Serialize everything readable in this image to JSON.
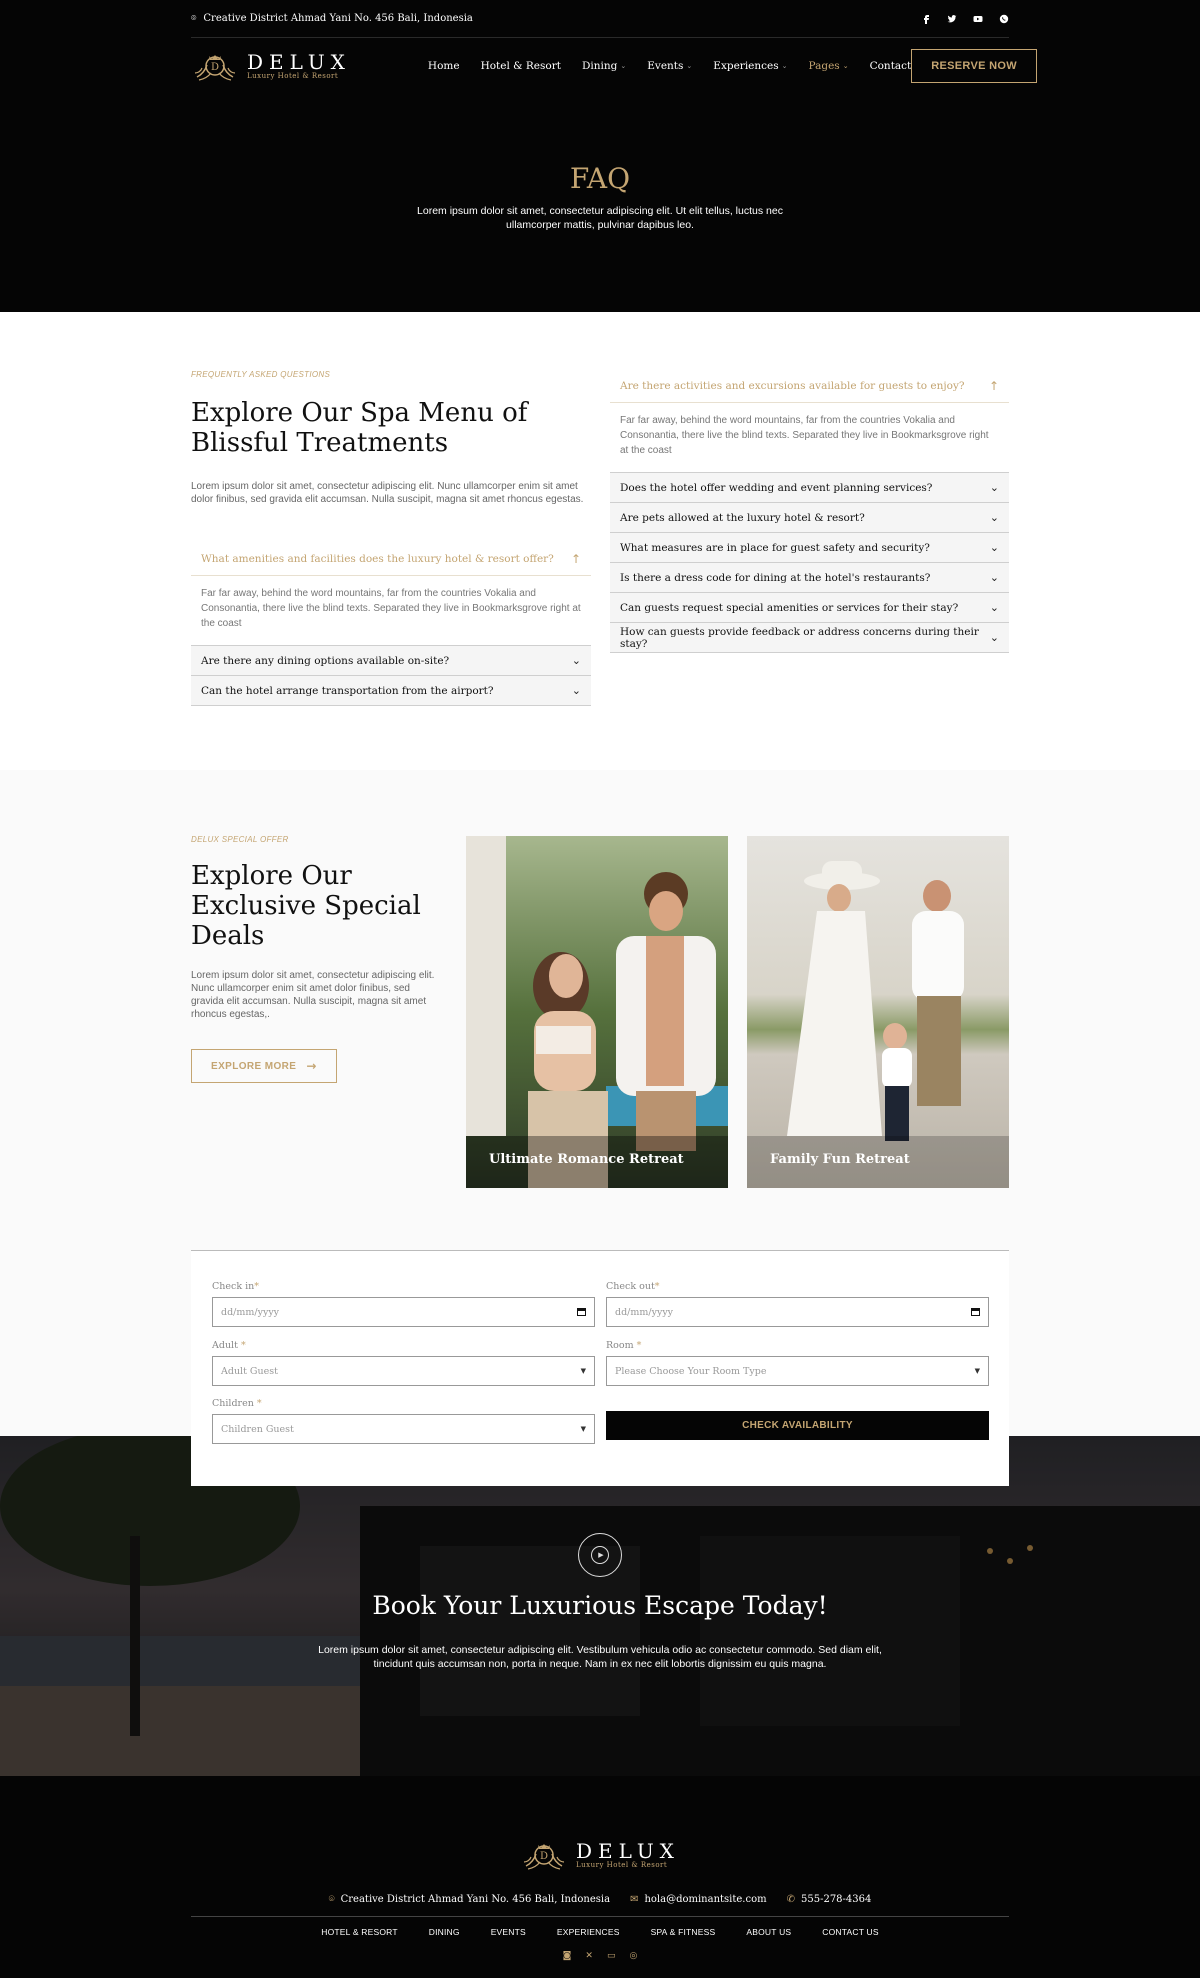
{
  "topbar": {
    "address": "Creative District Ahmad Yani No. 456 Bali, Indonesia",
    "social_icons": [
      "facebook-icon",
      "twitter-icon",
      "youtube-icon",
      "whatsapp-icon"
    ]
  },
  "brand": {
    "name": "DELUX",
    "tagline": "Luxury Hotel & Resort",
    "accent": "#c4a572",
    "dark": "#050505"
  },
  "nav": {
    "items": [
      {
        "label": "Home",
        "dropdown": false,
        "active": false
      },
      {
        "label": "Hotel & Resort",
        "dropdown": false,
        "active": false
      },
      {
        "label": "Dining",
        "dropdown": true,
        "active": false
      },
      {
        "label": "Events",
        "dropdown": true,
        "active": false
      },
      {
        "label": "Experiences",
        "dropdown": true,
        "active": false
      },
      {
        "label": "Pages",
        "dropdown": true,
        "active": true
      },
      {
        "label": "Contact",
        "dropdown": false,
        "active": false
      }
    ],
    "cta": "RESERVE NOW"
  },
  "hero": {
    "title": "FAQ",
    "subtitle": "Lorem ipsum dolor sit amet, consectetur adipiscing elit. Ut elit tellus, luctus nec ullamcorper mattis, pulvinar dapibus leo."
  },
  "faq": {
    "eyebrow": "FREQUENTLY ASKED QUESTIONS",
    "title": "Explore Our Spa Menu of Blissful Treatments",
    "intro": "Lorem ipsum dolor sit amet, consectetur adipiscing elit. Nunc ullamcorper enim sit amet dolor finibus, sed gravida elit accumsan. Nulla suscipit, magna sit amet rhoncus egestas.",
    "answer": "Far far away, behind the word mountains, far from the countries Vokalia and Consonantia, there live the blind texts. Separated they live in Bookmarksgrove right at the coast",
    "left": [
      {
        "q": "What amenities and facilities does the luxury hotel & resort offer?",
        "open": true
      },
      {
        "q": "Are there any dining options available on-site?",
        "open": false
      },
      {
        "q": "Can the hotel arrange transportation from the airport?",
        "open": false
      }
    ],
    "right": [
      {
        "q": "Are there activities and excursions available for guests to enjoy?",
        "open": true
      },
      {
        "q": "Does the hotel offer wedding and event planning services?",
        "open": false
      },
      {
        "q": "Are pets allowed at the luxury hotel & resort?",
        "open": false
      },
      {
        "q": "What measures are in place for guest safety and security?",
        "open": false
      },
      {
        "q": "Is there a dress code for dining at the hotel's restaurants?",
        "open": false
      },
      {
        "q": "Can guests request special amenities or services for their stay?",
        "open": false
      },
      {
        "q": "How can guests provide feedback or address concerns during their stay?",
        "open": false
      }
    ]
  },
  "deals": {
    "eyebrow": "DELUX SPECIAL OFFER",
    "title": "Explore Our Exclusive Special Deals",
    "intro": "Lorem ipsum dolor sit amet, consectetur adipiscing elit. Nunc ullamcorper enim sit amet dolor finibus, sed gravida elit accumsan. Nulla suscipit, magna sit amet rhoncus egestas,.",
    "button": "EXPLORE MORE",
    "cards": [
      {
        "caption": "Ultimate Romance Retreat"
      },
      {
        "caption": "Family Fun Retreat"
      }
    ]
  },
  "booking": {
    "checkin_label": "Check in",
    "checkin_placeholder": "dd/mm/yyyy",
    "checkout_label": "Check out",
    "checkout_placeholder": "dd/mm/yyyy",
    "adult_label": "Adult",
    "adult_value": "Adult Guest",
    "room_label": "Room",
    "room_value": "Please Choose Your Room Type",
    "children_label": "Children",
    "children_value": "Children Guest",
    "submit": "CHECK AVAILABILITY"
  },
  "cta": {
    "title": "Book Your Luxurious Escape Today!",
    "text": "Lorem ipsum dolor sit amet, consectetur adipiscing elit. Vestibulum vehicula odio ac consectetur commodo. Sed diam elit, tincidunt quis accumsan non, porta in neque. Nam in ex nec elit lobortis dignissim eu quis magna."
  },
  "footer": {
    "address": "Creative District Ahmad Yani No. 456 Bali, Indonesia",
    "email": "hola@dominantsite.com",
    "phone": "555-278-4364",
    "links": [
      "HOTEL & RESORT",
      "DINING",
      "EVENTS",
      "EXPERIENCES",
      "SPA & FITNESS",
      "ABOUT US",
      "CONTACT US"
    ],
    "social_icons": [
      "instagram-icon",
      "x-icon",
      "youtube-icon",
      "whatsapp-icon"
    ]
  }
}
